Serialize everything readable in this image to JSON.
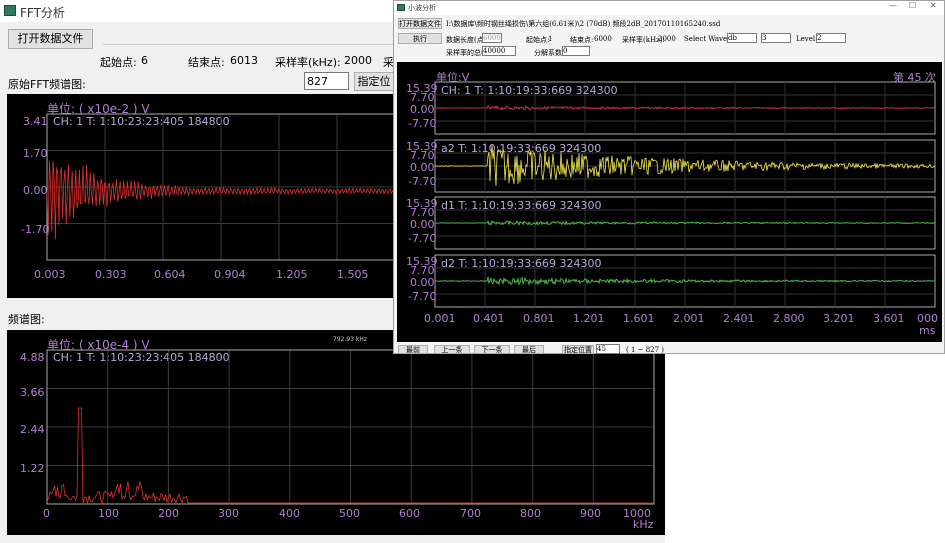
{
  "win1": {
    "title": "FFT分析",
    "open_button": "打开数据文件",
    "start_label": "起始点:",
    "start_value": "6",
    "end_label": "结束点:",
    "end_value": "6013",
    "rate_label": "采样率(kHz):",
    "rate_value": "2000",
    "rate_label_cut": "采",
    "orig_label": "原始FFT频谱图:",
    "pos_input": "827",
    "locate_button": "指定位",
    "plot1": {
      "unit": "单位: ( x10e-2 ) V",
      "info": "CH:  1  T:  1:10:23:23:405 184800",
      "yticks": [
        "3.41",
        "1.70",
        "0.00",
        "-1.70"
      ],
      "xticks": [
        "0.003",
        "0.303",
        "0.604",
        "0.904",
        "1.205",
        "1.505"
      ]
    },
    "spec_label": "频谱图:",
    "plot2": {
      "unit": "单位: ( x10e-4 ) V",
      "info": "CH:  1 T:  1:10:23:23:405 184800",
      "peak": "792.93 kHz",
      "yticks": [
        "4.88",
        "3.66",
        "2.44",
        "1.22",
        "0"
      ],
      "xticks": [
        "0",
        "100",
        "200",
        "300",
        "400",
        "500",
        "600",
        "700",
        "800",
        "900",
        "1000"
      ],
      "xunit": "kHz"
    }
  },
  "win2": {
    "title": "小波分析",
    "controls": [
      "—",
      "☐",
      "✕"
    ],
    "open_button": "打开数据文件",
    "path": "I:\\数据库\\频时钢丝绳损伤\\第六组(6.61米)\\2 (70dB) 频段2dB_20170110165240.ssd",
    "run_button": "执行",
    "len_label": "数据长度(点):",
    "len_value": "6000",
    "start_label": "起始点:",
    "start_value": "1",
    "end_label": "结束点:",
    "end_value": "6000",
    "rate_label": "采样率(kHz):",
    "rate_value": "2000",
    "wavelet_label": "Select Wavelet:",
    "wavelet_value": "db",
    "wavelet_order": "3",
    "level_label": "Level:",
    "level_value": "2",
    "total_label": "采样率的总帧:",
    "total_value": "40000",
    "decomp_label": "分解系数:",
    "decomp_value": "0",
    "unit": "单位:V",
    "count": "第 45 次",
    "subplots": [
      {
        "label": "CH:  1   T:   1:10:19:33:669 324300",
        "yticks": [
          "15.39",
          "7.70",
          "0.00",
          "-7.70"
        ]
      },
      {
        "label": "a2  T:   1:10:19:33:669 324300",
        "yticks": [
          "15.39",
          "7.70",
          "0.00",
          "-7.70"
        ]
      },
      {
        "label": "d1  T:   1:10:19:33:669 324300",
        "yticks": [
          "15.39",
          "7.70",
          "0.00",
          "-7.70"
        ]
      },
      {
        "label": "d2  T:   1:10:19:33:669 324300",
        "yticks": [
          "15.39",
          "7.70",
          "0.00",
          "-7.70"
        ]
      }
    ],
    "xticks": [
      "0.001",
      "0.401",
      "0.801",
      "1.201",
      "1.601",
      "2.001",
      "2.401",
      "2.800",
      "3.201",
      "3.601",
      "000"
    ],
    "xunit": "ms",
    "nav": [
      "最前",
      "上一条",
      "下一条",
      "最后"
    ],
    "locate_button": "指定位置",
    "locate_value": "45",
    "range": "( 1 ~ 827 )"
  },
  "colors": {
    "signal_red": "#e03030",
    "signal_yellow": "#f2e84a",
    "signal_green": "#4fcf4f",
    "tick_purple": "#b07fd0",
    "info_lavender": "#b7a9d9"
  }
}
